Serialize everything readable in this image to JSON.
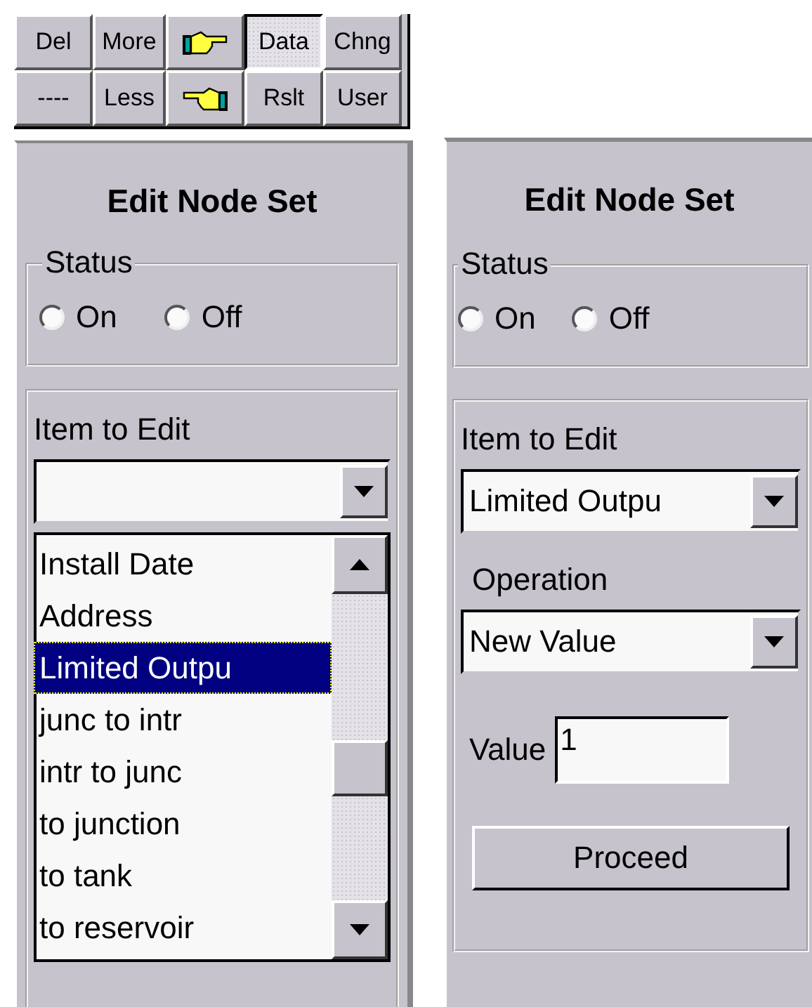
{
  "toolbar": {
    "buttons": [
      {
        "kind": "text",
        "label": "Del",
        "selected": false
      },
      {
        "kind": "text",
        "label": "More",
        "selected": false
      },
      {
        "kind": "point-right",
        "selected": false
      },
      {
        "kind": "text",
        "label": "Data",
        "selected": true
      },
      {
        "kind": "text",
        "label": "Chng",
        "selected": false
      },
      {
        "kind": "text",
        "label": "----",
        "selected": false
      },
      {
        "kind": "text",
        "label": "Less",
        "selected": false
      },
      {
        "kind": "point-left",
        "selected": false
      },
      {
        "kind": "text",
        "label": "Rslt",
        "selected": false
      },
      {
        "kind": "text",
        "label": "User",
        "selected": false
      }
    ]
  },
  "panels": [
    {
      "title": "Edit Node Set",
      "status": {
        "legend": "Status",
        "options": [
          {
            "label": "On",
            "selected": false
          },
          {
            "label": "Off",
            "selected": false
          }
        ]
      },
      "item_to_edit": {
        "label": "Item to Edit",
        "list": [
          {
            "label": "Install Date",
            "selected": false
          },
          {
            "label": "Address",
            "selected": false
          },
          {
            "label": "Limited Outpu",
            "selected": true
          },
          {
            "label": "junc to intr",
            "selected": false
          },
          {
            "label": "intr to junc",
            "selected": false
          },
          {
            "label": "to junction",
            "selected": false
          },
          {
            "label": "to tank",
            "selected": false
          },
          {
            "label": "to reservoir",
            "selected": false
          }
        ]
      }
    },
    {
      "title": "Edit Node Set",
      "status": {
        "legend": "Status",
        "options": [
          {
            "label": "On",
            "selected": false
          },
          {
            "label": "Off",
            "selected": false
          }
        ]
      },
      "item_to_edit": {
        "label": "Item to Edit",
        "value": "Limited Outpu"
      },
      "operation": {
        "label": "Operation",
        "value": "New Value"
      },
      "value_field": {
        "label": "Value",
        "value": "1"
      },
      "proceed_button": "Proceed"
    }
  ]
}
